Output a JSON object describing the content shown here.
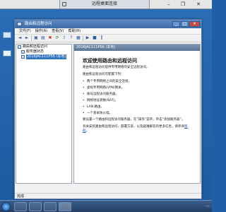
{
  "rdp": {
    "title": "远程桌面连接",
    "minimize": "–",
    "restore": "❐",
    "close": "✕"
  },
  "window": {
    "title": "路由和远程访问",
    "minimize": "_",
    "maximize": "□",
    "close": "✕"
  },
  "menu": [
    "文件(F)",
    "操作(A)",
    "查看(V)",
    "帮助(H)"
  ],
  "toolbar": {
    "back": "◄",
    "forward": "►",
    "up": "▣",
    "properties": "▤",
    "delete": "✖",
    "refresh": "⟳",
    "export": "⇪",
    "help": "?",
    "grid": "▦",
    "start": "▶",
    "stop": "■",
    "pause": "‖"
  },
  "tree": {
    "root": "路由和远程访问",
    "items": [
      "服务器状态",
      "2016JAC111P56 (本地)"
    ]
  },
  "panel": {
    "header": "2016JAC111P56 (本地)",
    "heading": "欢迎使用路由和远程访问",
    "intro": "路由和远程访问提供专用网络的安全远程访问。",
    "config_intro": "路由和远程访问可配置下列：",
    "bullets": [
      "两个专用网络之间的安全连接。",
      "虚拟专用网络(VPN)网关。",
      "拨号远程访问服务器。",
      "网络地址转换(NAT)。",
      "LAN 路由。",
      "一个基本防火墙。"
    ],
    "setup_text": "要设置一个路由和远程访问服务器，在“操作”菜单，单击“添加服务器”。",
    "more_text": "有关安装路由和远程访问、部署方案、以及疑难解答的更多信息，请参阅",
    "help_link": "帮助",
    "more_end": "。"
  },
  "status": "完成",
  "tray": {
    "time": "··:··"
  }
}
